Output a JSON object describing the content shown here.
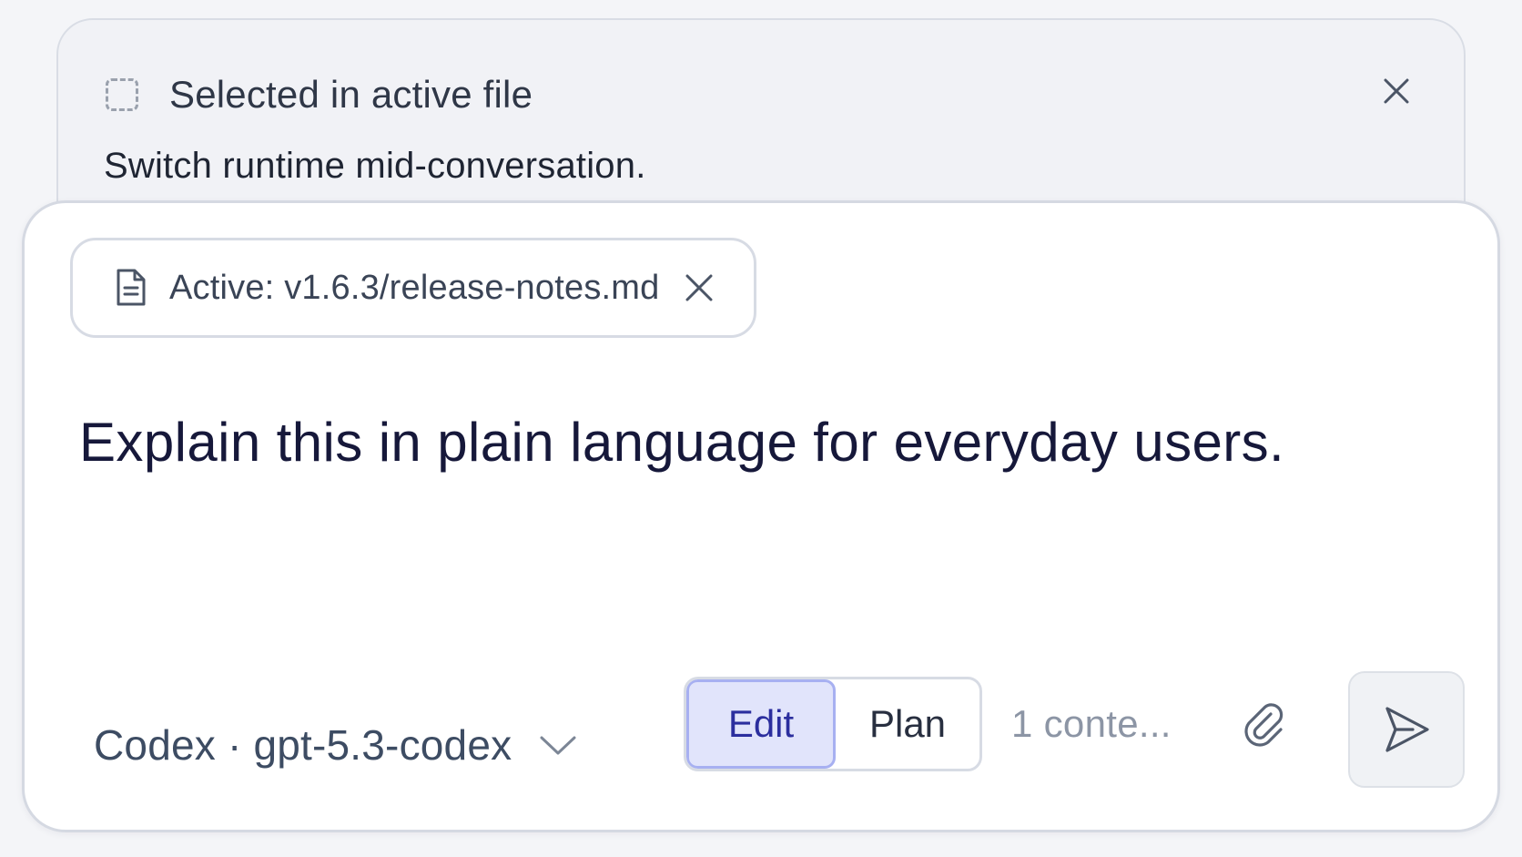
{
  "context": {
    "icon": "selection-dashed-icon",
    "title": "Selected in active file",
    "selected_text": "Switch runtime mid-conversation.",
    "close_icon": "close-icon"
  },
  "composer": {
    "active_file_chip": {
      "icon": "file-icon",
      "label": "Active: v1.6.3/release-notes.md",
      "close_icon": "close-icon"
    },
    "prompt": "Explain this in plain language for everyday users.",
    "model_selector": {
      "label": "Codex · gpt-5.3-codex",
      "icon": "chevron-down-icon"
    },
    "mode_toggle": {
      "options": [
        "Edit",
        "Plan"
      ],
      "selected": "Edit"
    },
    "context_count": "1 conte...",
    "attach_icon": "paperclip-icon",
    "send_icon": "send-icon"
  },
  "colors": {
    "accent": "#2b2e9e",
    "accent_bg": "#e1e4fb",
    "text_primary": "#16183a",
    "muted": "#8c95a5"
  }
}
